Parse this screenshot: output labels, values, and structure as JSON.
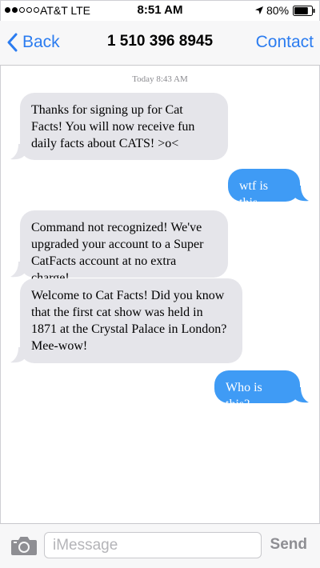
{
  "status_bar": {
    "carrier": "AT&T LTE",
    "time": "8:51 AM",
    "battery": "80%",
    "battery_level": 0.8,
    "signal_bars_filled": 2,
    "signal_bars_total": 5
  },
  "nav": {
    "back_label": "Back",
    "title": "1 510 396 8945",
    "contact_label": "Contact"
  },
  "thread": {
    "timestamp": "Today 8:43 AM",
    "messages": [
      {
        "direction": "incoming",
        "text": "Thanks for signing up for Cat Facts! You will now receive fun daily facts about CATS! >o<"
      },
      {
        "direction": "outgoing",
        "text": "wtf is this"
      },
      {
        "direction": "incoming",
        "text": "Command not recognized! We've upgraded your account to a Super CatFacts account at no extra charge!"
      },
      {
        "direction": "incoming",
        "text": "Welcome to Cat Facts! Did you know that the first cat show was held in 1871 at the Crystal Palace in London? Mee-wow!"
      },
      {
        "direction": "outgoing",
        "text": "Who is this?"
      }
    ]
  },
  "input_bar": {
    "placeholder": "iMessage",
    "value": "",
    "send_label": "Send"
  },
  "colors": {
    "accent": "#2b7cf0",
    "incoming_bubble": "#e5e5ea",
    "outgoing_bubble": "#3f9bf5",
    "send_disabled": "#8e8e93"
  },
  "icons": {
    "back": "chevron-left-icon",
    "location": "location-arrow-icon",
    "battery": "battery-icon",
    "camera": "camera-icon"
  }
}
